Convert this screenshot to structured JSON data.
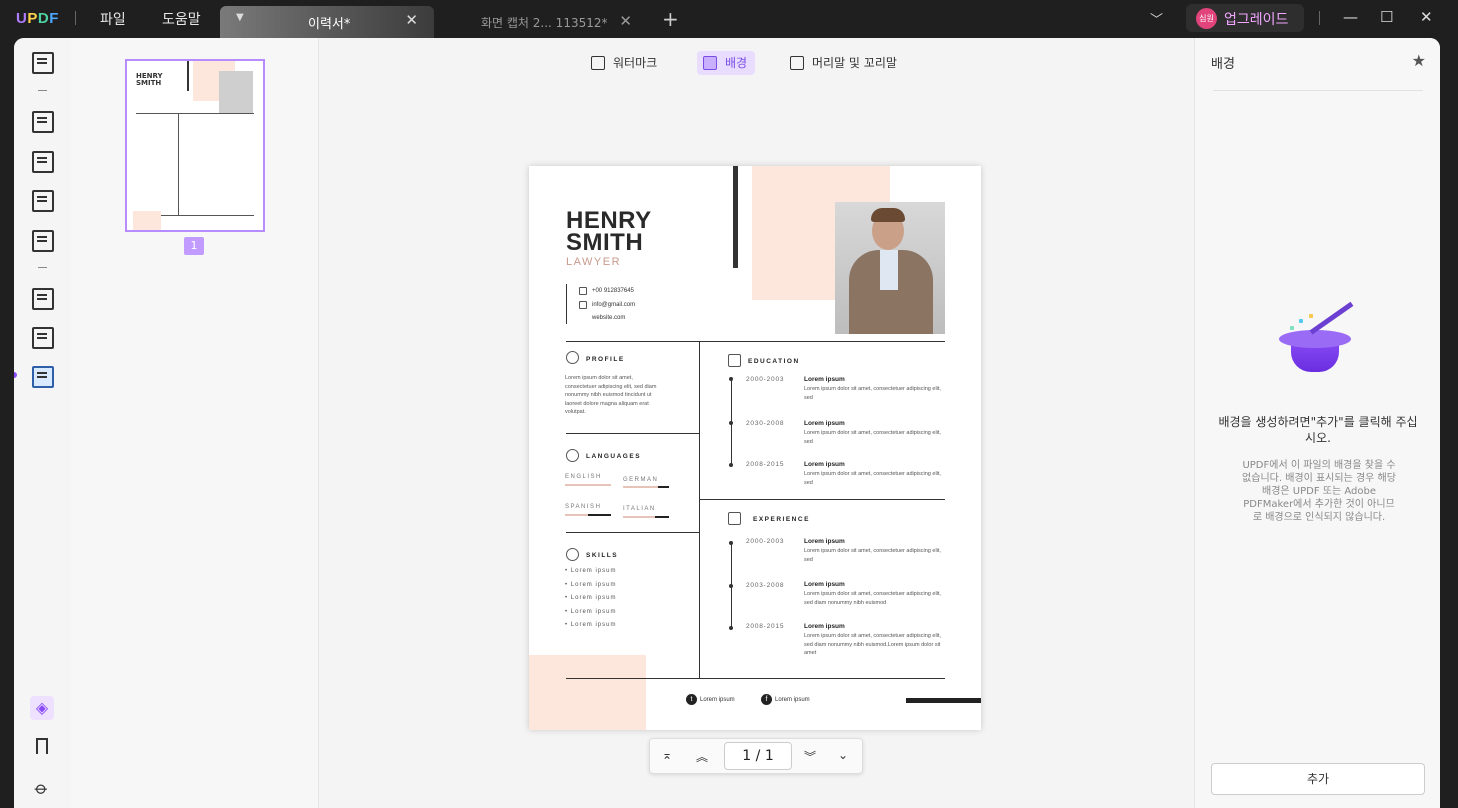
{
  "app": {
    "logo": {
      "u": "U",
      "p": "P",
      "d": "D",
      "f": "F"
    },
    "menu": {
      "file": "파일",
      "help": "도움말"
    },
    "tabs": [
      {
        "label": "이력서*",
        "active": true
      },
      {
        "label": "화면 캡처 2... 113512*",
        "active": false
      }
    ],
    "upgrade": {
      "avatar": "심원",
      "label": "업그레이드"
    },
    "window": {
      "close": "✕",
      "maximize": "☐",
      "minimize": "—"
    }
  },
  "toolbar": {
    "watermark": "워터마크",
    "background": "배경",
    "header_footer": "머리말 및 꼬리말",
    "active": "background"
  },
  "thumbnail": {
    "page_number": "1"
  },
  "document": {
    "name_line1": "HENRY",
    "name_line2": "SMITH",
    "role": "LAWYER",
    "phone": "+00 912837645",
    "email": "info@gmail.com",
    "website": "website.com",
    "profile": {
      "heading": "PROFILE",
      "text": "Lorem ipsum dolor sit amet, consectetuer adipiscing elit, sed diam nonummy nibh euismod tincidunt ut laoreet dolore magna aliquam erat volutpat."
    },
    "languages": {
      "heading": "LANGUAGES",
      "items": [
        {
          "name": "ENGLISH",
          "level": 0.0
        },
        {
          "name": "GERMAN",
          "level": 0.25
        },
        {
          "name": "SPANISH",
          "level": 0.5
        },
        {
          "name": "ITALIAN",
          "level": 0.3
        }
      ]
    },
    "skills": {
      "heading": "SKILLS",
      "items": [
        "• Lorem ipsum",
        "• Lorem ipsum",
        "• Lorem ipsum",
        "• Lorem ipsum",
        "• Lorem ipsum"
      ]
    },
    "education": {
      "heading": "EDUCATION",
      "items": [
        {
          "years": "2000-2003",
          "title": "Lorem ipsum",
          "desc": "Lorem ipsum dolor sit amet, consectetuer adipiscing elit, sed"
        },
        {
          "years": "2030-2008",
          "title": "Lorem ipsum",
          "desc": "Lorem ipsum dolor sit amet, consectetuer adipiscing elit, sed"
        },
        {
          "years": "2008-2015",
          "title": "Lorem ipsum",
          "desc": "Lorem ipsum dolor sit amet, consectetuer adipiscing elit, sed"
        }
      ]
    },
    "experience": {
      "heading": "EXPERIENCE",
      "items": [
        {
          "years": "2000-2003",
          "title": "Lorem ipsum",
          "desc": "Lorem ipsum dolor sit amet, consectetuer adipiscing elit, sed"
        },
        {
          "years": "2003-2008",
          "title": "Lorem ipsum",
          "desc": "Lorem ipsum dolor sit amet, consectetuer adipiscing elit, sed diam nonummy nibh euismod"
        },
        {
          "years": "2008-2015",
          "title": "Lorem ipsum",
          "desc": "Lorem ipsum dolor sit amet, consectetuer adipiscing elit, sed diam nonummy nibh euismod.Lorem ipsum dolor sit amet"
        }
      ]
    },
    "footer": {
      "twitter": "Lorem ipsum",
      "facebook": "Lorem ipsum"
    }
  },
  "pagenav": {
    "current": "1",
    "separator": "/",
    "total": "1"
  },
  "rightpanel": {
    "title": "배경",
    "message": "배경을 생성하려면\"추가\"를 클릭해 주십시오.",
    "description": "UPDF에서 이 파일의 배경을 찾을 수 없습니다. 배경이 표시되는 경우 해당 배경은 UPDF 또는 Adobe PDFMaker에서 추가한 것이 아니므로 배경으로 인식되지 않습니다.",
    "add_button": "추가"
  },
  "colors": {
    "accent": "#8a4cf6",
    "peach": "#fde6dc",
    "titlebar": "#1f1f1f"
  }
}
